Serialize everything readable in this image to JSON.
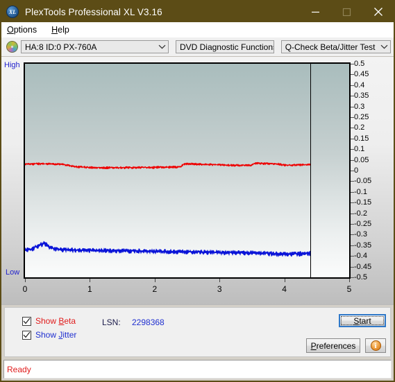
{
  "window": {
    "title": "PlexTools Professional XL V3.16",
    "icon": "disc-xl-icon",
    "minimize": "minimize-icon",
    "maximize": "maximize-icon",
    "close": "close-icon",
    "titlebar_color": "#5c4c16"
  },
  "menu": {
    "items": [
      {
        "label": "Options",
        "accel": "O"
      },
      {
        "label": "Help",
        "accel": "H"
      }
    ]
  },
  "toolbar": {
    "drive_icon": "cd-disc-icon",
    "drive": "HA:8 ID:0  PX-760A",
    "function": "DVD Diagnostic Functions",
    "test": "Q-Check Beta/Jitter Test"
  },
  "controls": {
    "show_beta_label_pre": "Show ",
    "show_beta_label_accel": "B",
    "show_beta_label_post": "eta",
    "show_beta_checked": true,
    "show_jitter_label_pre": "Show ",
    "show_jitter_label_accel": "J",
    "show_jitter_label_post": "itter",
    "show_jitter_checked": true,
    "lsn_label": "LSN:",
    "lsn_value": "2298368",
    "start_label_pre": "",
    "start_label_accel": "S",
    "start_label_post": "tart",
    "prefs_label_pre": "",
    "prefs_label_accel": "P",
    "prefs_label_post": "references",
    "info_glyph": "i",
    "beta_color": "#e01b1b",
    "jitter_color": "#1f2fd0"
  },
  "status": {
    "text": "Ready"
  },
  "chart_data": {
    "type": "line",
    "title": "",
    "xlabel": "",
    "ylabel": "",
    "high_label": "High",
    "low_label": "Low",
    "xlim": [
      0,
      5
    ],
    "ylim": [
      -0.5,
      0.5
    ],
    "xticks": [
      0,
      1,
      2,
      3,
      4,
      5
    ],
    "xtick_labels": [
      "0",
      "1",
      "2",
      "3",
      "4",
      "5"
    ],
    "yticks": [
      0.5,
      0.45,
      0.4,
      0.35,
      0.3,
      0.25,
      0.2,
      0.15,
      0.1,
      0.05,
      0,
      -0.05,
      -0.1,
      -0.15,
      -0.2,
      -0.25,
      -0.3,
      -0.35,
      -0.4,
      -0.45,
      -0.5
    ],
    "ytick_labels": [
      "0.5",
      "0.45",
      "0.4",
      "0.35",
      "0.3",
      "0.25",
      "0.2",
      "0.15",
      "0.1",
      "0.05",
      "0",
      "-0.05",
      "-0.1",
      "-0.15",
      "-0.2",
      "-0.25",
      "-0.3",
      "-0.35",
      "-0.4",
      "-0.45",
      "-0.5"
    ],
    "grid": true,
    "grid_style": "dashed",
    "data_end_x": 4.4,
    "marker_line_x": 4.4,
    "series": [
      {
        "name": "Beta",
        "color": "#ee0000",
        "x": [
          0.0,
          0.1,
          0.2,
          0.3,
          0.4,
          0.5,
          0.6,
          0.7,
          0.8,
          0.9,
          1.0,
          1.1,
          1.2,
          1.3,
          1.4,
          1.5,
          1.6,
          1.7,
          1.8,
          1.9,
          2.0,
          2.1,
          2.2,
          2.3,
          2.4,
          2.45,
          2.5,
          2.6,
          2.7,
          2.8,
          2.9,
          3.0,
          3.1,
          3.2,
          3.3,
          3.4,
          3.5,
          3.55,
          3.6,
          3.7,
          3.8,
          3.9,
          4.0,
          4.1,
          4.2,
          4.3,
          4.4
        ],
        "values": [
          0.03,
          0.031,
          0.032,
          0.032,
          0.031,
          0.03,
          0.028,
          0.022,
          0.018,
          0.016,
          0.015,
          0.015,
          0.014,
          0.014,
          0.014,
          0.014,
          0.014,
          0.014,
          0.015,
          0.015,
          0.015,
          0.016,
          0.016,
          0.017,
          0.017,
          0.03,
          0.031,
          0.031,
          0.03,
          0.029,
          0.028,
          0.027,
          0.026,
          0.025,
          0.025,
          0.026,
          0.026,
          0.034,
          0.034,
          0.033,
          0.032,
          0.031,
          0.026,
          0.026,
          0.027,
          0.028,
          0.029
        ],
        "noise_amplitude": 0.006
      },
      {
        "name": "Jitter",
        "color": "#0a14d8",
        "x": [
          0.0,
          0.1,
          0.2,
          0.3,
          0.4,
          0.5,
          0.6,
          0.7,
          0.8,
          0.9,
          1.0,
          1.1,
          1.2,
          1.3,
          1.4,
          1.5,
          1.6,
          1.7,
          1.8,
          1.9,
          2.0,
          2.1,
          2.2,
          2.3,
          2.4,
          2.5,
          2.6,
          2.7,
          2.8,
          2.9,
          3.0,
          3.1,
          3.2,
          3.3,
          3.4,
          3.5,
          3.6,
          3.7,
          3.8,
          3.9,
          4.0,
          4.1,
          4.2,
          4.3,
          4.4
        ],
        "values": [
          -0.372,
          -0.368,
          -0.352,
          -0.34,
          -0.362,
          -0.368,
          -0.37,
          -0.371,
          -0.372,
          -0.372,
          -0.373,
          -0.373,
          -0.374,
          -0.374,
          -0.375,
          -0.375,
          -0.376,
          -0.376,
          -0.377,
          -0.377,
          -0.378,
          -0.378,
          -0.379,
          -0.379,
          -0.38,
          -0.38,
          -0.381,
          -0.381,
          -0.382,
          -0.382,
          -0.383,
          -0.383,
          -0.384,
          -0.384,
          -0.385,
          -0.385,
          -0.386,
          -0.387,
          -0.388,
          -0.39,
          -0.391,
          -0.39,
          -0.389,
          -0.388,
          -0.387
        ],
        "noise_amplitude": 0.012
      }
    ]
  }
}
